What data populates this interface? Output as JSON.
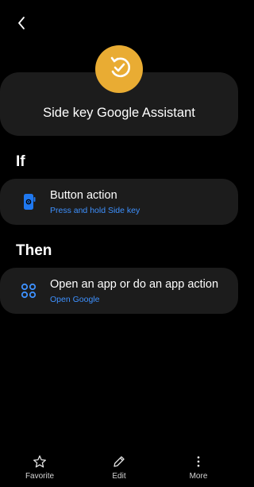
{
  "routine": {
    "title": "Side key Google Assistant",
    "badge_color": "#e9ac33"
  },
  "sections": {
    "if_label": "If",
    "then_label": "Then"
  },
  "if_action": {
    "title": "Button action",
    "subtitle": "Press and hold Side key",
    "icon": "phone-side-key-icon"
  },
  "then_action": {
    "title": "Open an app or do an app action",
    "subtitle": "Open Google",
    "icon": "app-grid-icon"
  },
  "bottom_nav": {
    "favorite_label": "Favorite",
    "edit_label": "Edit",
    "more_label": "More"
  },
  "colors": {
    "background": "#000000",
    "card": "#1c1c1c",
    "accent_blue": "#3e91ff",
    "badge": "#e9ac33"
  }
}
